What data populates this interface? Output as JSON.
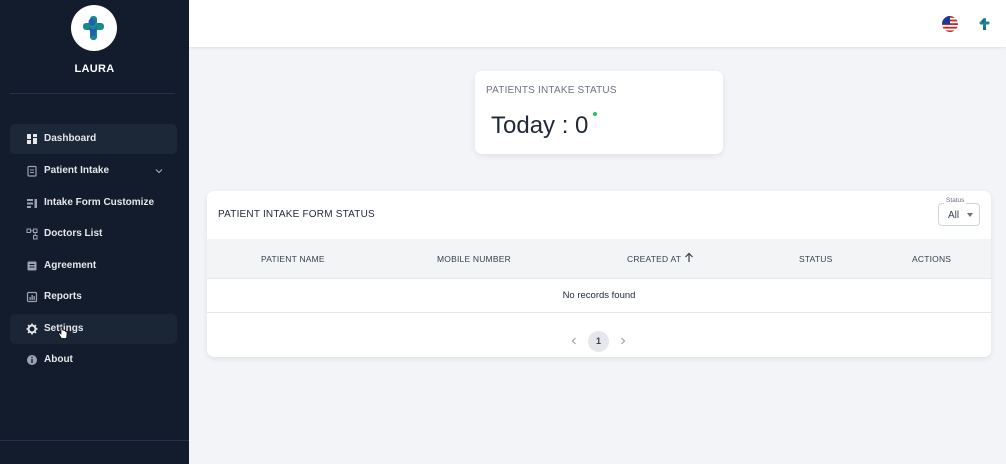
{
  "sidebar": {
    "brand": "LAURA",
    "items": [
      {
        "label": "Dashboard",
        "icon": "dashboard-icon"
      },
      {
        "label": "Patient Intake",
        "icon": "clipboard-icon",
        "expandable": true
      },
      {
        "label": "Intake Form Customize",
        "icon": "form-customize-icon"
      },
      {
        "label": "Doctors List",
        "icon": "doctors-list-icon"
      },
      {
        "label": "Agreement",
        "icon": "agreement-icon"
      },
      {
        "label": "Reports",
        "icon": "reports-icon"
      },
      {
        "label": "Settings",
        "icon": "gear-icon"
      },
      {
        "label": "About",
        "icon": "info-icon"
      }
    ],
    "active_item": "Dashboard"
  },
  "topbar": {
    "language_flag": "us-flag-icon",
    "app_icon": "laura-logo-icon"
  },
  "intake_card": {
    "title": "PATIENTS INTAKE STATUS",
    "value_text": "Today : 0"
  },
  "table": {
    "title": "PATIENT INTAKE FORM STATUS",
    "status_filter": {
      "legend": "Status",
      "value": "All"
    },
    "columns": [
      "PATIENT NAME",
      "MOBILE NUMBER",
      "CREATED AT",
      "STATUS",
      "ACTIONS"
    ],
    "rows": [],
    "empty_message": "No records found",
    "pagination": {
      "current_page": "1"
    }
  },
  "colors": {
    "sidebar_bg": "#121c2c",
    "accent_teal": "#1a8a86",
    "accent_blue": "#1f5fb4",
    "status_green": "#22c55e"
  }
}
